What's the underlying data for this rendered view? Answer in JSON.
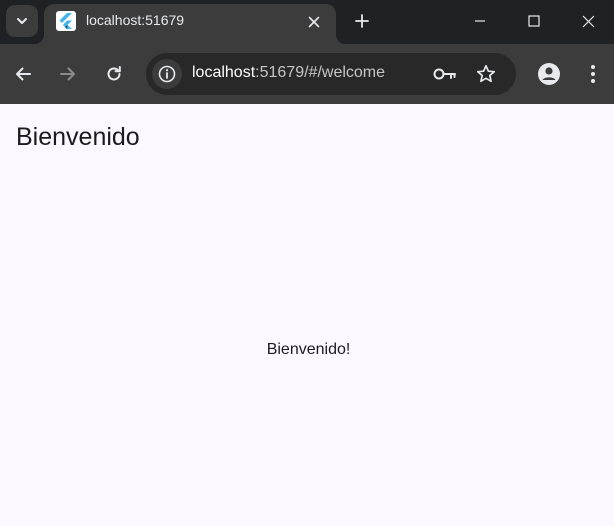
{
  "browser": {
    "tab": {
      "title": "localhost:51679",
      "favicon": "flutter-logo-icon"
    },
    "address_bar": {
      "host": "localhost",
      "path": ":51679/#/welcome"
    },
    "icons": {
      "tab_search": "chevron-down-icon",
      "tab_close": "close-icon",
      "new_tab": "plus-icon",
      "minimize": "minimize-icon",
      "maximize": "maximize-icon",
      "window_close": "close-icon",
      "back": "arrow-left-icon",
      "forward": "arrow-right-icon",
      "reload": "reload-icon",
      "site_info": "info-icon",
      "password": "key-icon",
      "bookmark": "star-icon",
      "profile": "person-icon",
      "menu": "more-vert-icon"
    }
  },
  "app": {
    "app_bar_title": "Bienvenido",
    "body_text": "Bienvenido!"
  },
  "colors": {
    "page_background": "#fdf7ff",
    "text": "#1d1b20",
    "browser_frame": "#202124",
    "toolbar": "#3c3c3c",
    "omnibox": "#282828",
    "flutter_blue": "#45b4e8",
    "flutter_navy": "#0f4a7a"
  }
}
